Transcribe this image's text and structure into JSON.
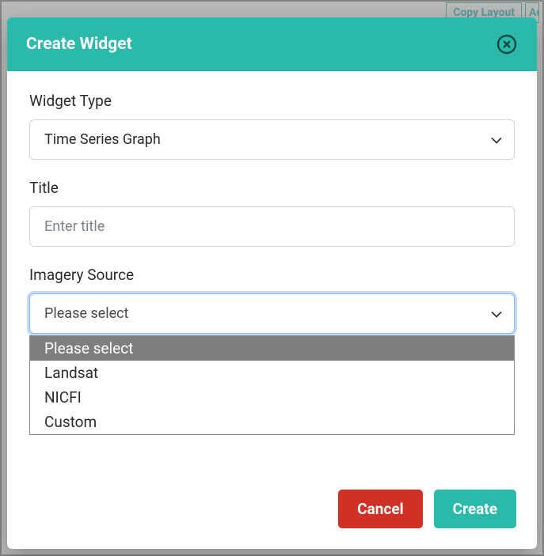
{
  "background": {
    "copy_layout": "Copy Layout",
    "add_partial": "Ad"
  },
  "modal": {
    "title": "Create Widget",
    "fields": {
      "widget_type": {
        "label": "Widget Type",
        "value": "Time Series Graph"
      },
      "title": {
        "label": "Title",
        "placeholder": "Enter title",
        "value": ""
      },
      "imagery_source": {
        "label": "Imagery Source",
        "value": "Please select",
        "options": [
          "Please select",
          "Landsat",
          "NICFI",
          "Custom"
        ]
      }
    },
    "buttons": {
      "cancel": "Cancel",
      "create": "Create"
    }
  }
}
